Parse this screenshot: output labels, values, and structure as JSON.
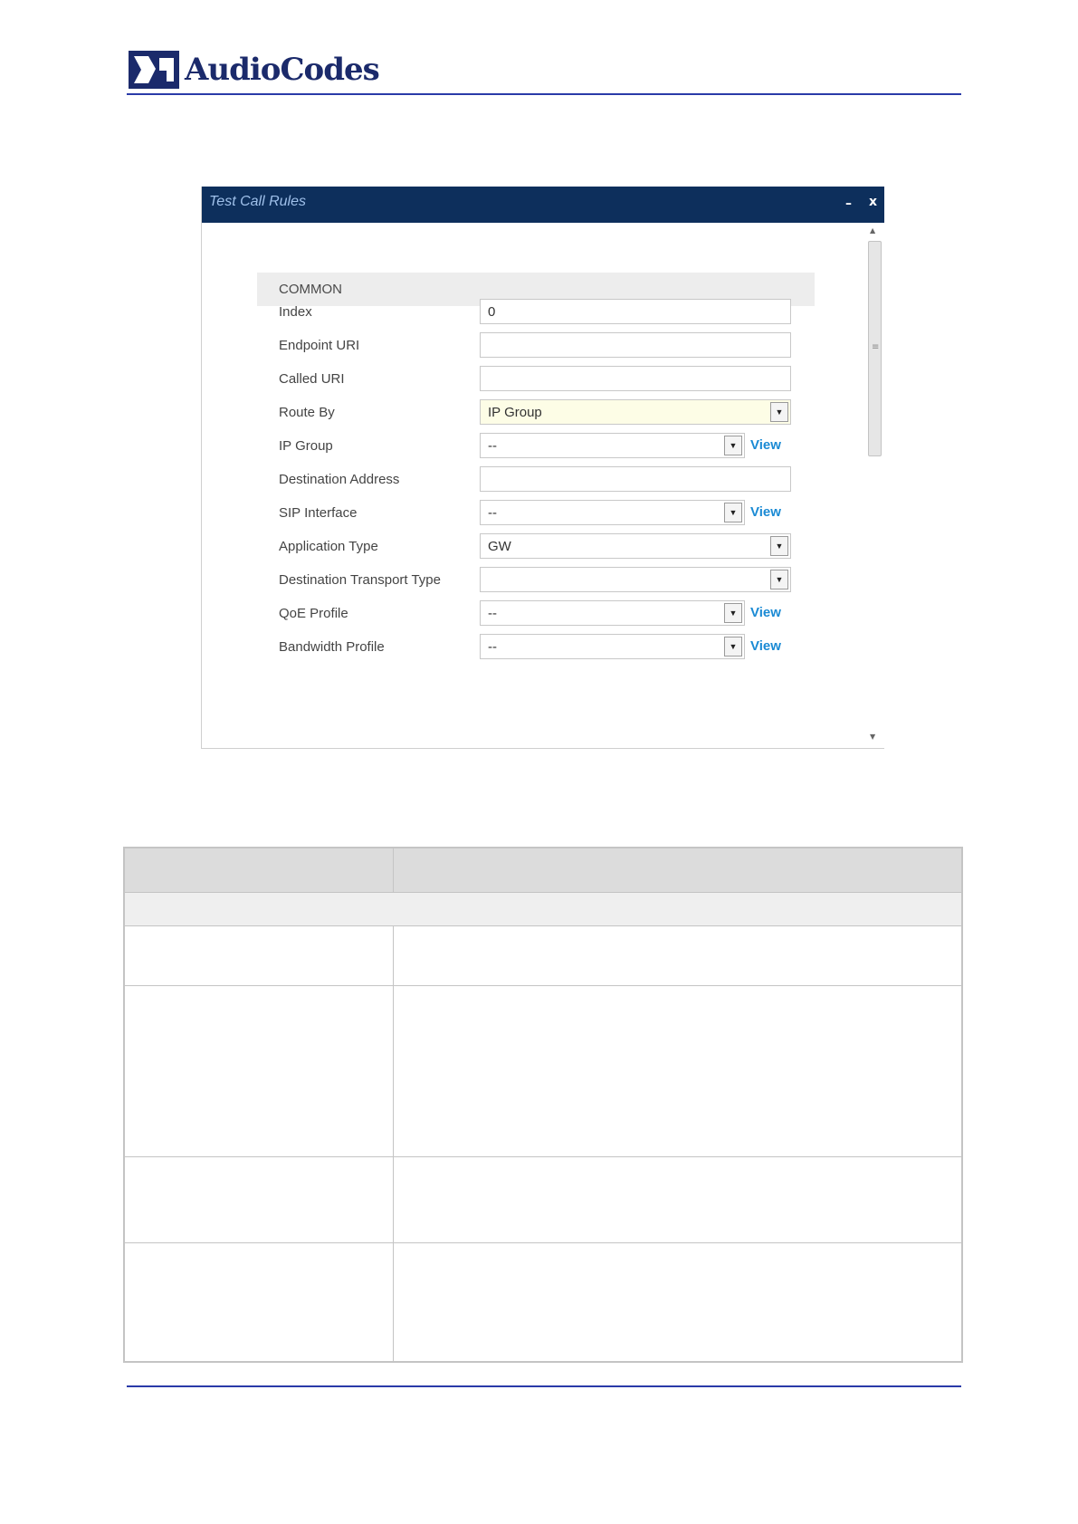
{
  "header": {
    "logo_text": "AudioCodes"
  },
  "dialog": {
    "title": "Test Call Rules",
    "minimize": "–",
    "close": "x",
    "section": "COMMON",
    "fields": [
      {
        "label": "Index",
        "value": "0"
      },
      {
        "label": "Endpoint URI",
        "value": ""
      },
      {
        "label": "Called URI",
        "value": ""
      },
      {
        "label": "Route By",
        "value": "IP Group"
      },
      {
        "label": "IP Group",
        "value": "--",
        "link": "View"
      },
      {
        "label": "Destination Address",
        "value": ""
      },
      {
        "label": "SIP Interface",
        "value": "--",
        "link": "View"
      },
      {
        "label": "Application Type",
        "value": "GW"
      },
      {
        "label": "Destination Transport Type",
        "value": ""
      },
      {
        "label": "QoE Profile",
        "value": "--",
        "link": "View"
      },
      {
        "label": "Bandwidth Profile",
        "value": "--",
        "link": "View"
      }
    ]
  }
}
